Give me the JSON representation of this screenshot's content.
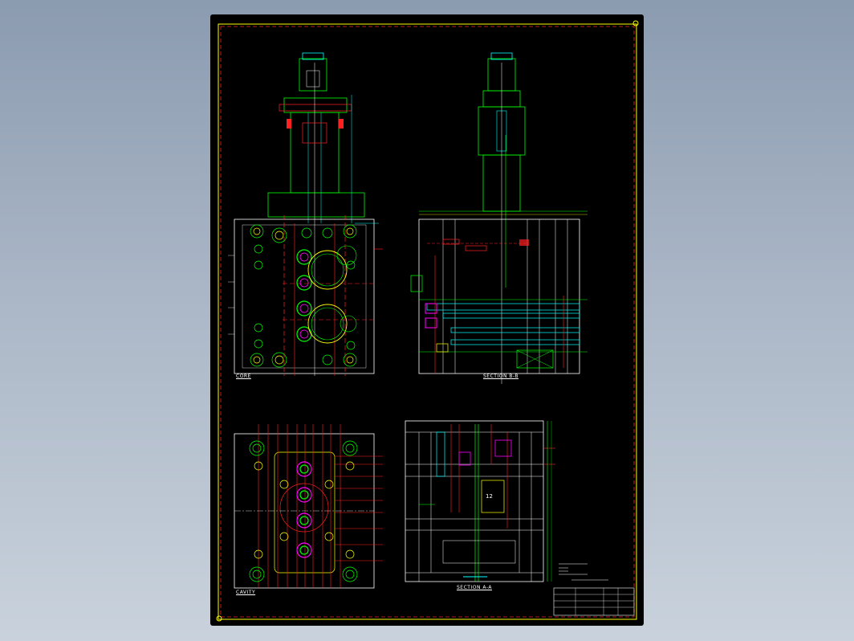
{
  "views": {
    "core_label": "CORE",
    "section_bb_label": "SECTION B-B",
    "cavity_label": "CAVITY",
    "section_aa_label": "SECTION A-A"
  },
  "colors": {
    "background": "#000000",
    "frame": "#ffff00",
    "red": "#ff2020",
    "green": "#00ff00",
    "cyan": "#00ffff",
    "magenta": "#ff00ff",
    "white": "#ffffff",
    "yellow": "#ffff00"
  }
}
